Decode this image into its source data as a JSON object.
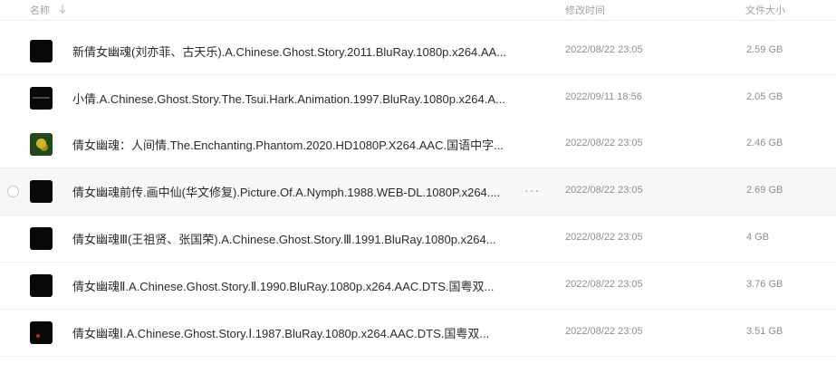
{
  "header": {
    "name_label": "名称",
    "modified_label": "修改时间",
    "size_label": "文件大小",
    "sort_icon": "sort-descending-arrow-icon"
  },
  "rows": [
    {
      "name": "新倩女幽魂(刘亦菲、古天乐).A.Chinese.Ghost.Story.2011.BluRay.1080p.x264.AA...",
      "modified": "2022/08/22 23:05",
      "size": "2.59 GB",
      "thumb": "video-thumbnail-icon"
    },
    {
      "name": "小倩.A.Chinese.Ghost.Story.The.Tsui.Hark.Animation.1997.BluRay.1080p.x264.A...",
      "modified": "2022/09/11 18:56",
      "size": "2.05 GB",
      "thumb": "video-thumbnail-icon"
    },
    {
      "name": "倩女幽魂：人间情.The.Enchanting.Phantom.2020.HD1080P.X264.AAC.国语中字...",
      "modified": "2022/08/22 23:05",
      "size": "2.46 GB",
      "thumb": "video-thumbnail-icon"
    },
    {
      "name": "倩女幽魂前传.画中仙(华文修复).Picture.Of.A.Nymph.1988.WEB-DL.1080P.x264....",
      "modified": "2022/08/22 23:05",
      "size": "2.69 GB",
      "thumb": "video-thumbnail-icon",
      "more": "···"
    },
    {
      "name": "倩女幽魂Ⅲ(王祖贤、张国荣).A.Chinese.Ghost.Story.Ⅲ.1991.BluRay.1080p.x264...",
      "modified": "2022/08/22 23:05",
      "size": "4 GB",
      "thumb": "video-thumbnail-icon"
    },
    {
      "name": "倩女幽魂Ⅱ.A.Chinese.Ghost.Story.Ⅱ.1990.BluRay.1080p.x264.AAC.DTS.国粤双...",
      "modified": "2022/08/22 23:05",
      "size": "3.76 GB",
      "thumb": "video-thumbnail-icon"
    },
    {
      "name": "倩女幽魂Ⅰ.A.Chinese.Ghost.Story.Ⅰ.1987.BluRay.1080p.x264.AAC.DTS.国粤双...",
      "modified": "2022/08/22 23:05",
      "size": "3.51 GB",
      "thumb": "video-thumbnail-icon"
    }
  ],
  "colors": {
    "header_text": "#a3a3a3",
    "name_text": "#2b2b2b",
    "meta_text": "#8f8f8f",
    "hover_row": "#f7f7f8",
    "divider": "#efefef"
  }
}
